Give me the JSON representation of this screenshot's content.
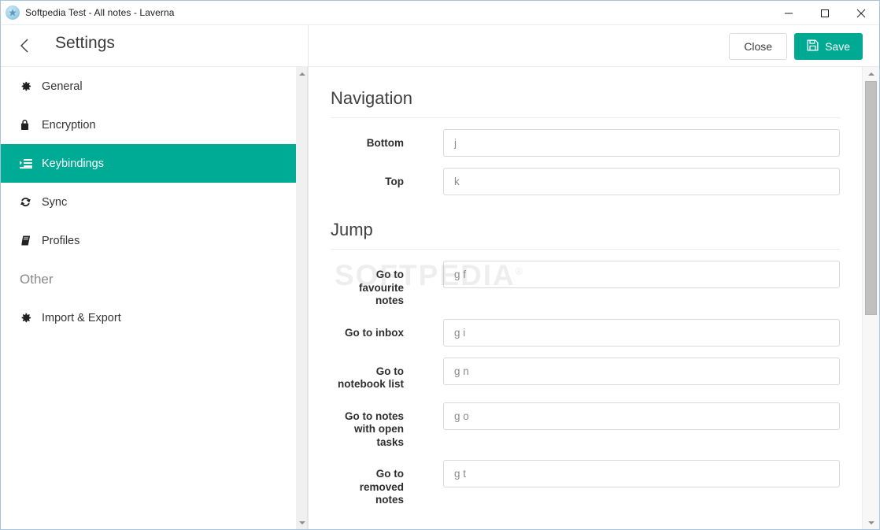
{
  "window": {
    "title": "Softpedia Test - All notes - Laverna",
    "app_icon": "laverna-app-icon",
    "controls": {
      "minimize": "minimize-icon",
      "maximize": "maximize-icon",
      "close": "close-icon"
    }
  },
  "header": {
    "back_label": "back-chevron-icon",
    "title": "Settings",
    "close_label": "Close",
    "save_label": "Save",
    "save_icon": "floppy-save-icon",
    "accent_color": "#00a991"
  },
  "sidebar": {
    "active_color": "#00ab95",
    "items": [
      {
        "label": "General",
        "icon": "gear-icon",
        "active": false
      },
      {
        "label": "Encryption",
        "icon": "lock-icon",
        "active": false
      },
      {
        "label": "Keybindings",
        "icon": "keyboard-list-icon",
        "active": true
      },
      {
        "label": "Sync",
        "icon": "refresh-icon",
        "active": false
      },
      {
        "label": "Profiles",
        "icon": "book-icon",
        "active": false
      }
    ],
    "group_label": "Other",
    "other_items": [
      {
        "label": "Import & Export",
        "icon": "gear-icon",
        "active": false
      }
    ]
  },
  "watermark": {
    "text": "SOFTPEDIA",
    "mark": "®"
  },
  "main": {
    "sections": [
      {
        "heading": "Navigation",
        "fields": [
          {
            "label": "Bottom",
            "value": "j"
          },
          {
            "label": "Top",
            "value": "k"
          }
        ]
      },
      {
        "heading": "Jump",
        "fields": [
          {
            "label": "Go to favourite notes",
            "value": "g f"
          },
          {
            "label": "Go to inbox",
            "value": "g i"
          },
          {
            "label": "Go to notebook list",
            "value": "g n"
          },
          {
            "label": "Go to notes with open tasks",
            "value": "g o"
          },
          {
            "label": "Go to removed notes",
            "value": "g t"
          }
        ]
      }
    ]
  }
}
